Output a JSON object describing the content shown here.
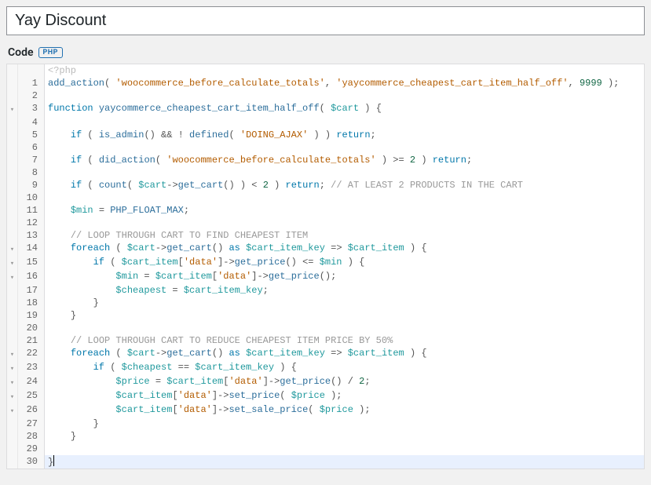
{
  "title_value": "Yay Discount",
  "section": {
    "label": "Code",
    "badge": "PHP"
  },
  "ghost_line": "<?php",
  "lines": [
    {
      "n": 1,
      "fold": "",
      "indent": 0,
      "tokens": [
        [
          "fn",
          "add_action"
        ],
        [
          "pl",
          "( "
        ],
        [
          "str",
          "'woocommerce_before_calculate_totals'"
        ],
        [
          "pl",
          ", "
        ],
        [
          "str",
          "'yaycommerce_cheapest_cart_item_half_off'"
        ],
        [
          "pl",
          ", "
        ],
        [
          "num",
          "9999"
        ],
        [
          "pl",
          " );"
        ]
      ]
    },
    {
      "n": 2,
      "fold": "",
      "indent": 0,
      "tokens": []
    },
    {
      "n": 3,
      "fold": "▾",
      "indent": 0,
      "tokens": [
        [
          "kw",
          "function"
        ],
        [
          "pl",
          " "
        ],
        [
          "fn",
          "yaycommerce_cheapest_cart_item_half_off"
        ],
        [
          "pl",
          "( "
        ],
        [
          "var",
          "$cart"
        ],
        [
          "pl",
          " ) {"
        ]
      ]
    },
    {
      "n": 4,
      "fold": "",
      "indent": 0,
      "tokens": []
    },
    {
      "n": 5,
      "fold": "",
      "indent": 1,
      "tokens": [
        [
          "kw",
          "if"
        ],
        [
          "pl",
          " ( "
        ],
        [
          "fn",
          "is_admin"
        ],
        [
          "pl",
          "() && ! "
        ],
        [
          "fn",
          "defined"
        ],
        [
          "pl",
          "( "
        ],
        [
          "str",
          "'DOING_AJAX'"
        ],
        [
          "pl",
          " ) ) "
        ],
        [
          "kw",
          "return"
        ],
        [
          "pl",
          ";"
        ]
      ]
    },
    {
      "n": 6,
      "fold": "",
      "indent": 0,
      "tokens": []
    },
    {
      "n": 7,
      "fold": "",
      "indent": 1,
      "tokens": [
        [
          "kw",
          "if"
        ],
        [
          "pl",
          " ( "
        ],
        [
          "fn",
          "did_action"
        ],
        [
          "pl",
          "( "
        ],
        [
          "str",
          "'woocommerce_before_calculate_totals'"
        ],
        [
          "pl",
          " ) >= "
        ],
        [
          "num",
          "2"
        ],
        [
          "pl",
          " ) "
        ],
        [
          "kw",
          "return"
        ],
        [
          "pl",
          ";"
        ]
      ]
    },
    {
      "n": 8,
      "fold": "",
      "indent": 0,
      "tokens": []
    },
    {
      "n": 9,
      "fold": "",
      "indent": 1,
      "tokens": [
        [
          "kw",
          "if"
        ],
        [
          "pl",
          " ( "
        ],
        [
          "fn",
          "count"
        ],
        [
          "pl",
          "( "
        ],
        [
          "var",
          "$cart"
        ],
        [
          "pl",
          "->"
        ],
        [
          "fn",
          "get_cart"
        ],
        [
          "pl",
          "() ) < "
        ],
        [
          "num",
          "2"
        ],
        [
          "pl",
          " ) "
        ],
        [
          "kw",
          "return"
        ],
        [
          "pl",
          "; "
        ],
        [
          "cm",
          "// AT LEAST 2 PRODUCTS IN THE CART"
        ]
      ]
    },
    {
      "n": 10,
      "fold": "",
      "indent": 0,
      "tokens": []
    },
    {
      "n": 11,
      "fold": "",
      "indent": 1,
      "tokens": [
        [
          "var",
          "$min"
        ],
        [
          "pl",
          " = "
        ],
        [
          "fn",
          "PHP_FLOAT_MAX"
        ],
        [
          "pl",
          ";"
        ]
      ]
    },
    {
      "n": 12,
      "fold": "",
      "indent": 0,
      "tokens": []
    },
    {
      "n": 13,
      "fold": "",
      "indent": 1,
      "tokens": [
        [
          "cm",
          "// LOOP THROUGH CART TO FIND CHEAPEST ITEM"
        ]
      ]
    },
    {
      "n": 14,
      "fold": "▾",
      "indent": 1,
      "tokens": [
        [
          "kw",
          "foreach"
        ],
        [
          "pl",
          " ( "
        ],
        [
          "var",
          "$cart"
        ],
        [
          "pl",
          "->"
        ],
        [
          "fn",
          "get_cart"
        ],
        [
          "pl",
          "() "
        ],
        [
          "kw",
          "as"
        ],
        [
          "pl",
          " "
        ],
        [
          "var",
          "$cart_item_key"
        ],
        [
          "pl",
          " => "
        ],
        [
          "var",
          "$cart_item"
        ],
        [
          "pl",
          " ) {"
        ]
      ]
    },
    {
      "n": 15,
      "fold": "▾",
      "indent": 2,
      "tokens": [
        [
          "kw",
          "if"
        ],
        [
          "pl",
          " ( "
        ],
        [
          "var",
          "$cart_item"
        ],
        [
          "pl",
          "["
        ],
        [
          "str",
          "'data'"
        ],
        [
          "pl",
          "]->"
        ],
        [
          "fn",
          "get_price"
        ],
        [
          "pl",
          "() <= "
        ],
        [
          "var",
          "$min"
        ],
        [
          "pl",
          " ) {"
        ]
      ]
    },
    {
      "n": 16,
      "fold": "▾",
      "indent": 3,
      "tokens": [
        [
          "var",
          "$min"
        ],
        [
          "pl",
          " = "
        ],
        [
          "var",
          "$cart_item"
        ],
        [
          "pl",
          "["
        ],
        [
          "str",
          "'data'"
        ],
        [
          "pl",
          "]->"
        ],
        [
          "fn",
          "get_price"
        ],
        [
          "pl",
          "();"
        ]
      ]
    },
    {
      "n": 17,
      "fold": "",
      "indent": 3,
      "tokens": [
        [
          "var",
          "$cheapest"
        ],
        [
          "pl",
          " = "
        ],
        [
          "var",
          "$cart_item_key"
        ],
        [
          "pl",
          ";"
        ]
      ]
    },
    {
      "n": 18,
      "fold": "",
      "indent": 2,
      "tokens": [
        [
          "pl",
          "}"
        ]
      ]
    },
    {
      "n": 19,
      "fold": "",
      "indent": 1,
      "tokens": [
        [
          "pl",
          "}"
        ]
      ]
    },
    {
      "n": 20,
      "fold": "",
      "indent": 0,
      "tokens": []
    },
    {
      "n": 21,
      "fold": "",
      "indent": 1,
      "tokens": [
        [
          "cm",
          "// LOOP THROUGH CART TO REDUCE CHEAPEST ITEM PRICE BY 50%"
        ]
      ]
    },
    {
      "n": 22,
      "fold": "▾",
      "indent": 1,
      "tokens": [
        [
          "kw",
          "foreach"
        ],
        [
          "pl",
          " ( "
        ],
        [
          "var",
          "$cart"
        ],
        [
          "pl",
          "->"
        ],
        [
          "fn",
          "get_cart"
        ],
        [
          "pl",
          "() "
        ],
        [
          "kw",
          "as"
        ],
        [
          "pl",
          " "
        ],
        [
          "var",
          "$cart_item_key"
        ],
        [
          "pl",
          " => "
        ],
        [
          "var",
          "$cart_item"
        ],
        [
          "pl",
          " ) {"
        ]
      ]
    },
    {
      "n": 23,
      "fold": "▾",
      "indent": 2,
      "tokens": [
        [
          "kw",
          "if"
        ],
        [
          "pl",
          " ( "
        ],
        [
          "var",
          "$cheapest"
        ],
        [
          "pl",
          " == "
        ],
        [
          "var",
          "$cart_item_key"
        ],
        [
          "pl",
          " ) {"
        ]
      ]
    },
    {
      "n": 24,
      "fold": "▾",
      "indent": 3,
      "tokens": [
        [
          "var",
          "$price"
        ],
        [
          "pl",
          " = "
        ],
        [
          "var",
          "$cart_item"
        ],
        [
          "pl",
          "["
        ],
        [
          "str",
          "'data'"
        ],
        [
          "pl",
          "]->"
        ],
        [
          "fn",
          "get_price"
        ],
        [
          "pl",
          "() / "
        ],
        [
          "num",
          "2"
        ],
        [
          "pl",
          ";"
        ]
      ]
    },
    {
      "n": 25,
      "fold": "▾",
      "indent": 3,
      "tokens": [
        [
          "var",
          "$cart_item"
        ],
        [
          "pl",
          "["
        ],
        [
          "str",
          "'data'"
        ],
        [
          "pl",
          "]->"
        ],
        [
          "fn",
          "set_price"
        ],
        [
          "pl",
          "( "
        ],
        [
          "var",
          "$price"
        ],
        [
          "pl",
          " );"
        ]
      ]
    },
    {
      "n": 26,
      "fold": "▾",
      "indent": 3,
      "tokens": [
        [
          "var",
          "$cart_item"
        ],
        [
          "pl",
          "["
        ],
        [
          "str",
          "'data'"
        ],
        [
          "pl",
          "]->"
        ],
        [
          "fn",
          "set_sale_price"
        ],
        [
          "pl",
          "( "
        ],
        [
          "var",
          "$price"
        ],
        [
          "pl",
          " );"
        ]
      ]
    },
    {
      "n": 27,
      "fold": "",
      "indent": 2,
      "tokens": [
        [
          "pl",
          "}"
        ]
      ]
    },
    {
      "n": 28,
      "fold": "",
      "indent": 1,
      "tokens": [
        [
          "pl",
          "}"
        ]
      ]
    },
    {
      "n": 29,
      "fold": "",
      "indent": 0,
      "tokens": []
    },
    {
      "n": 30,
      "fold": "",
      "indent": 0,
      "tokens": [
        [
          "pl",
          "}"
        ]
      ],
      "active": true,
      "cursor_after": true
    }
  ]
}
